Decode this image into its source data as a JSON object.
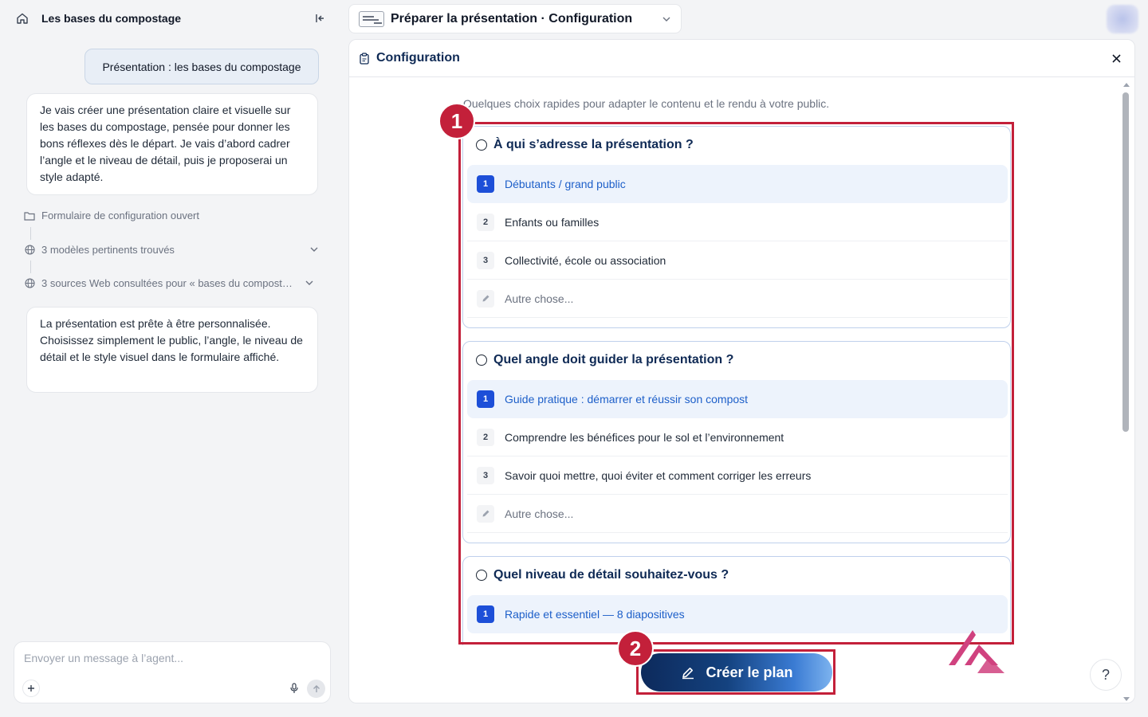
{
  "conversation": {
    "title": "Les bases du compostage",
    "user_message": "Présentation : les bases du compostage",
    "assistant_message_1": "Je vais créer une présentation claire et visuelle sur les bases du compostage, pensée pour donner les bons réflexes dès le départ. Je vais d’abord cadrer l’angle et le niveau de détail, puis je proposerai un style adapté.",
    "steps": [
      {
        "label": "Formulaire de configuration ouvert",
        "icon": "folder-icon"
      },
      {
        "label": "3 modèles pertinents trouvés",
        "icon": "globe-icon"
      },
      {
        "label": "3 sources Web consultées pour « bases du compostage »",
        "icon": "globe-icon"
      }
    ],
    "assistant_message_2": "La présentation est prête à être personnalisée. Choisissez simplement le public, l’angle, le niveau de détail et le style visuel dans le formulaire affiché.",
    "composer_placeholder": "Envoyer un message à l’agent..."
  },
  "top_dropdown": {
    "label": "Préparer la présentation · Configuration"
  },
  "panel": {
    "title": "Configuration",
    "intro": "Quelques choix rapides pour adapter le contenu et le rendu à votre public.",
    "questions": [
      {
        "title": "À qui s’adresse la présentation ?",
        "options": [
          {
            "num": "1",
            "label": "Débutants / grand public",
            "selected": true
          },
          {
            "num": "2",
            "label": "Enfants ou familles"
          },
          {
            "num": "3",
            "label": "Collectivité, école ou association"
          },
          {
            "num": "",
            "label": "Autre chose..."
          }
        ]
      },
      {
        "title": "Quel angle doit guider la présentation ?",
        "options": [
          {
            "num": "1",
            "label": "Guide pratique : démarrer et réussir son compost",
            "selected": true
          },
          {
            "num": "2",
            "label": "Comprendre les bénéfices pour le sol et l’environnement"
          },
          {
            "num": "3",
            "label": "Savoir quoi mettre, quoi éviter et comment corriger les erreurs"
          },
          {
            "num": "",
            "label": "Autre chose..."
          }
        ]
      },
      {
        "title": "Quel niveau de détail souhaitez-vous ?",
        "options": [
          {
            "num": "1",
            "label": "Rapide et essentiel — 8 diapositives",
            "selected": true
          }
        ]
      }
    ],
    "create_button": "Créer le plan",
    "help": "?"
  },
  "annotations": {
    "badge1": "1",
    "badge2": "2"
  },
  "colors": {
    "accent": "#1d4fd8",
    "annotation": "#c3203a",
    "navy": "#0f2a55"
  }
}
